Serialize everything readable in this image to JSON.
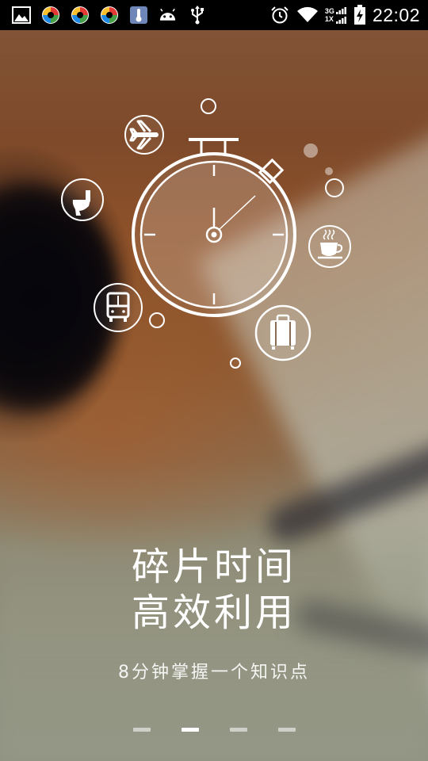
{
  "status_bar": {
    "time": "22:02",
    "network_top": "3G",
    "network_bottom": "1X",
    "icons": [
      "gallery-icon",
      "app-icon",
      "app-icon",
      "app-icon",
      "thermometer-app-icon",
      "android-icon",
      "usb-icon",
      "alarm-icon",
      "wifi-icon",
      "signal-icon",
      "battery-charging-icon"
    ]
  },
  "illustration": {
    "icons": [
      "stopwatch-icon",
      "airplane-icon",
      "toilet-icon",
      "bus-icon",
      "luggage-icon",
      "coffee-cup-icon",
      "bubble-circle"
    ]
  },
  "headline": {
    "line1": "碎片时间",
    "line2": "高效利用"
  },
  "subtitle": "8分钟掌握一个知识点",
  "pager": {
    "total": 4,
    "active_index": 1
  }
}
